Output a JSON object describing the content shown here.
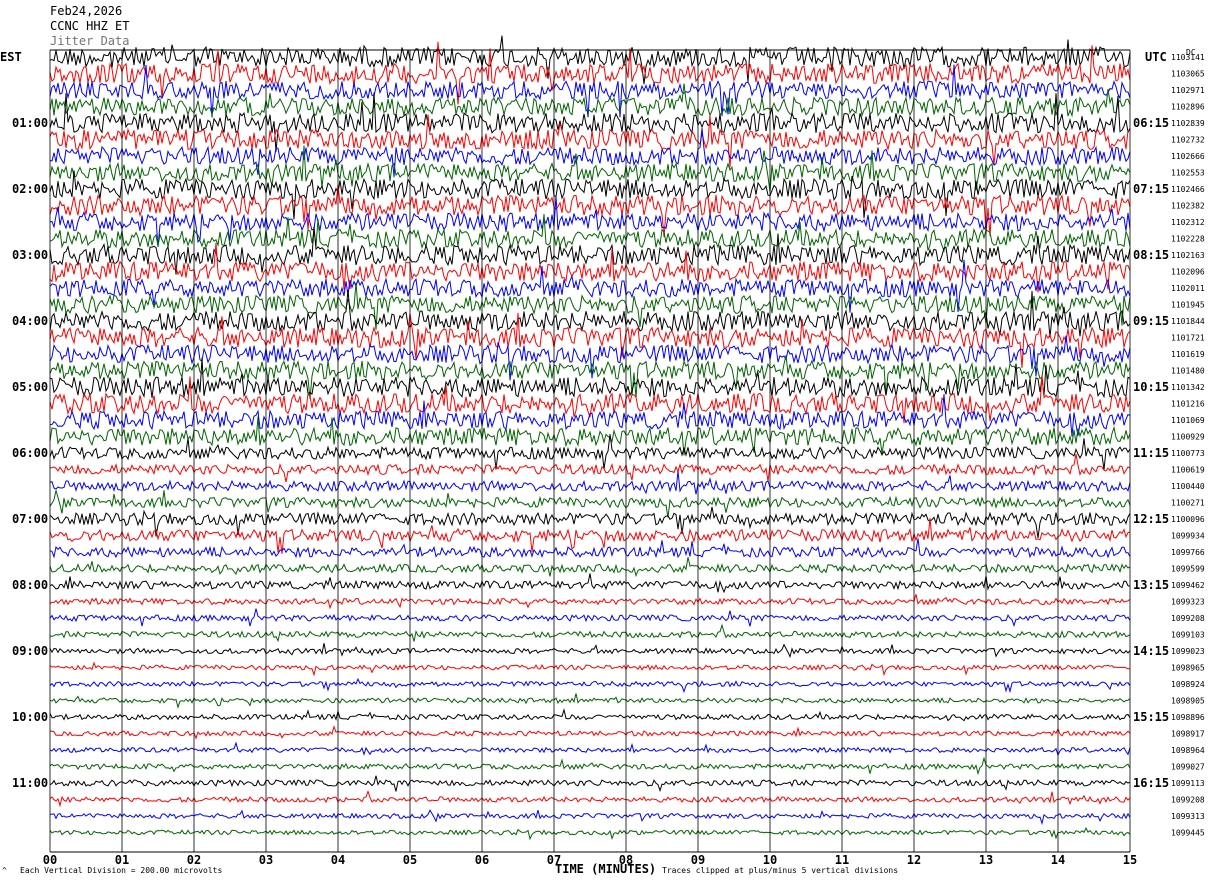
{
  "header": {
    "date": "Feb24,2026",
    "station": "CCNC HHZ ET",
    "overlay_text": "Jitter Data"
  },
  "left_timezone_label": "EST",
  "right_timezone_label": "UTC",
  "dc_label": "DC",
  "colors": {
    "trace_cycle": [
      "#000000",
      "#ff0000",
      "#0000ff",
      "#006400"
    ],
    "grid": "#000000",
    "background": "#ffffff"
  },
  "footer": {
    "small_mark": "^",
    "scale_note": "Each Vertical Division =  200.00 microvolts",
    "clip_note": "Traces clipped at plus/minus 5 vertical divisions"
  },
  "chart_data": {
    "type": "line",
    "title": "Feb24,2026",
    "subtitle": "CCNC HHZ ET",
    "xlabel": "TIME (MINUTES)",
    "x_tick_labels": [
      "00",
      "01",
      "02",
      "03",
      "04",
      "05",
      "06",
      "07",
      "08",
      "09",
      "10",
      "11",
      "12",
      "13",
      "14",
      "15"
    ],
    "xlim": [
      0,
      15
    ],
    "traces_per_hour": 4,
    "trace_count": 48,
    "left_hour_labels": [
      "01:00",
      "02:00",
      "03:00",
      "04:00",
      "05:00",
      "06:00",
      "07:00",
      "08:00",
      "09:00",
      "10:00",
      "11:00"
    ],
    "right_hour_labels": [
      "06:15",
      "07:15",
      "08:15",
      "09:15",
      "10:15",
      "11:15",
      "12:15",
      "13:15",
      "14:15",
      "15:15",
      "16:15"
    ],
    "dc_offsets": [
      1103141,
      1103065,
      1102971,
      1102896,
      1102839,
      1102732,
      1102666,
      1102553,
      1102466,
      1102382,
      1102312,
      1102228,
      1102163,
      1102096,
      1102011,
      1101945,
      1101844,
      1101721,
      1101619,
      1101480,
      1101342,
      1101216,
      1101069,
      1100929,
      1100773,
      1100619,
      1100440,
      1100271,
      1100096,
      1099934,
      1099766,
      1099599,
      1099462,
      1099323,
      1099208,
      1099103,
      1099023,
      1098965,
      1098924,
      1098905,
      1098896,
      1098917,
      1098964,
      1099027,
      1099113,
      1099208,
      1099313,
      1099445
    ],
    "trace_amplitude_level": [
      10,
      10,
      9,
      9,
      10,
      10,
      9,
      9,
      10,
      10,
      9,
      9,
      10,
      10,
      9,
      9,
      10,
      10,
      9,
      9,
      10,
      10,
      9,
      9,
      6,
      5,
      5,
      5,
      6,
      6,
      5,
      4,
      4,
      3,
      3,
      3,
      2.6,
      2.4,
      2.4,
      2.4,
      2.6,
      2.4,
      2.4,
      2.6,
      3,
      2.6,
      2.4,
      2.2
    ],
    "scale_microvolts_per_division": 200.0,
    "clip_divisions": 5
  }
}
